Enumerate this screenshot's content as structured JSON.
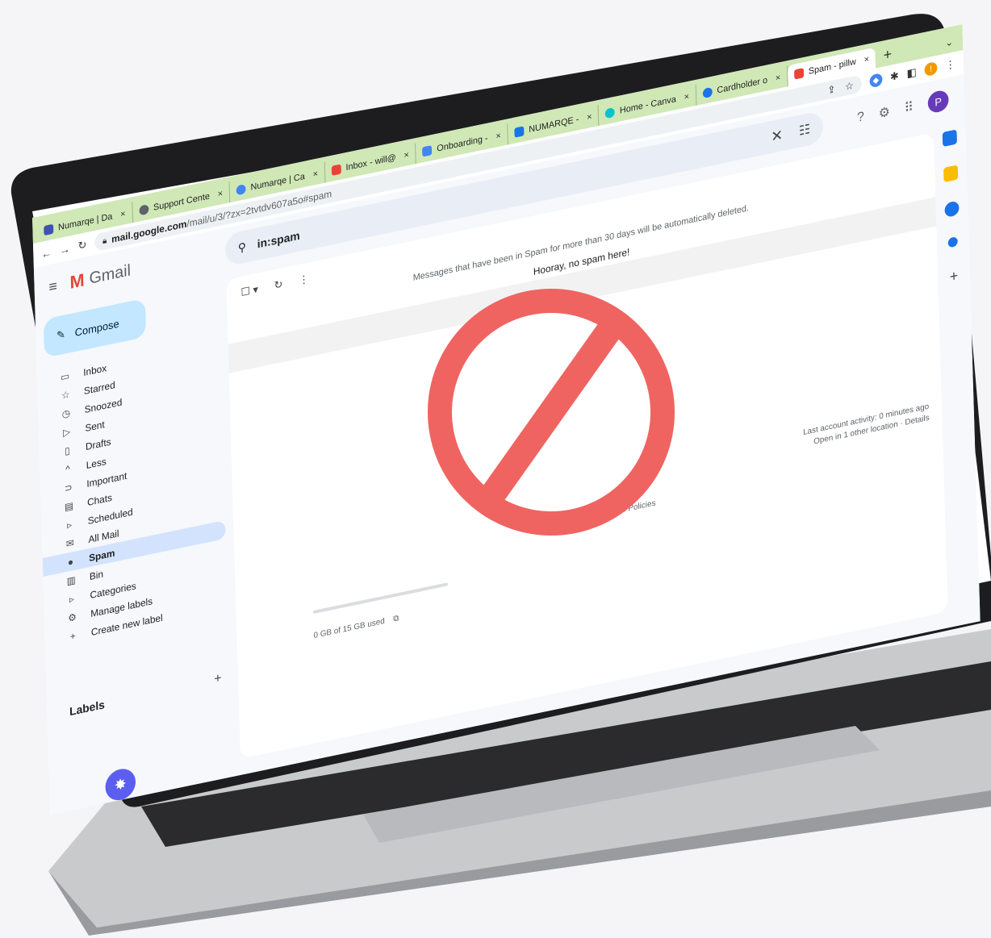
{
  "browser": {
    "tabs": [
      {
        "label": "Numarqe | Da",
        "fav_color": "#3f51b5"
      },
      {
        "label": "Support Cente",
        "fav_color": "#5f6368"
      },
      {
        "label": "Numarqe | Ca",
        "fav_color": "#4285f4"
      },
      {
        "label": "Inbox - will@",
        "fav_color": "#ea4335"
      },
      {
        "label": "Onboarding -",
        "fav_color": "#4285f4"
      },
      {
        "label": "NUMARQE -",
        "fav_color": "#1a73e8"
      },
      {
        "label": "Home - Canva",
        "fav_color": "#00c4cc"
      },
      {
        "label": "Cardholder o",
        "fav_color": "#1a73e8"
      },
      {
        "label": "Spam - pillw",
        "fav_color": "#ea4335"
      }
    ],
    "close_glyph": "×",
    "new_tab_glyph": "+",
    "url_host": "mail.google.com",
    "url_path": "/mail/u/3/?zx=2tvtdv607a5o#spam",
    "ext_badge": "!"
  },
  "gmail": {
    "logo_text": "Gmail",
    "search_query": "in:spam",
    "compose_label": "Compose",
    "avatar_letter": "P",
    "nav": [
      {
        "label": "Inbox",
        "icon": "inbox-icon",
        "glyph": "▭"
      },
      {
        "label": "Starred",
        "icon": "star-icon",
        "glyph": "☆"
      },
      {
        "label": "Snoozed",
        "icon": "clock-icon",
        "glyph": "◷"
      },
      {
        "label": "Sent",
        "icon": "send-icon",
        "glyph": "▷"
      },
      {
        "label": "Drafts",
        "icon": "draft-icon",
        "glyph": "▯"
      },
      {
        "label": "Less",
        "icon": "chevron-up-icon",
        "glyph": "^"
      },
      {
        "label": "Important",
        "icon": "important-icon",
        "glyph": "⊃"
      },
      {
        "label": "Chats",
        "icon": "chat-icon",
        "glyph": "▤"
      },
      {
        "label": "Scheduled",
        "icon": "scheduled-icon",
        "glyph": "▹"
      },
      {
        "label": "All Mail",
        "icon": "all-mail-icon",
        "glyph": "✉"
      },
      {
        "label": "Spam",
        "icon": "spam-icon",
        "glyph": "●",
        "active": true
      },
      {
        "label": "Bin",
        "icon": "bin-icon",
        "glyph": "▥"
      },
      {
        "label": "Categories",
        "icon": "label-icon",
        "glyph": "▹"
      },
      {
        "label": "Manage labels",
        "icon": "settings-icon",
        "glyph": "⚙"
      },
      {
        "label": "Create new label",
        "icon": "plus-icon",
        "glyph": "+"
      }
    ],
    "labels_heading": "Labels",
    "notice": "Messages that have been in Spam for more than 30 days will be automatically deleted.",
    "empty_message": "Hooray, no spam here!",
    "footer_links": "Terms · Privacy · Programme Policies",
    "activity_line1": "Last account activity: 0 minutes ago",
    "activity_line2": "Open in 1 other location · Details",
    "storage": "0 GB of 15 GB used"
  },
  "overlay": {
    "symbol": "no-entry",
    "color": "#ef6461"
  }
}
